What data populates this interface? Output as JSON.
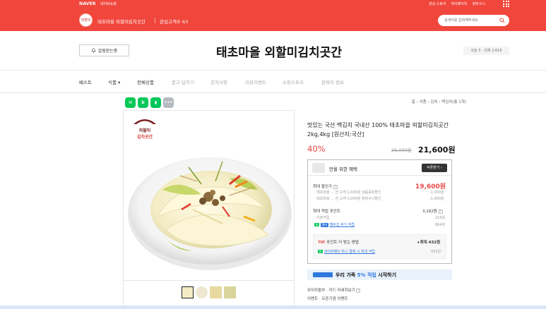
{
  "gnb": {
    "logo": "NAVER",
    "shopping": "네이버쇼핑",
    "links": [
      "관심 스토어",
      "마이페이지",
      "장바구니"
    ]
  },
  "store": {
    "avatar_text": "외할미",
    "name": "태초마을 외할미김치곳간",
    "fav": "관심고객수 63",
    "search_placeholder": "검색어를 입력해주세요"
  },
  "header": {
    "alarm_label": "알림받는중",
    "title": "태초마을 외할미김치곳간",
    "visitors": "오늘 5 · 전체 2,618"
  },
  "categories": [
    "베스트",
    "식품",
    "전체상품",
    "묻고 답하기",
    "공지사항",
    "리뷰이벤트",
    "쇼핑스토리",
    "판매자 정보"
  ],
  "breadcrumb": "홈 › 식품 › 김치 › 백김치(총 1개)",
  "logo_stamp": [
    "외할미",
    "김치곳간"
  ],
  "product": {
    "title": "맛있는 국산 백김치 국내산 100% 태초마을 외할미김치곳간 2kg,4kg [원산지:국산]",
    "discount": "40%",
    "original_price": "36,000원",
    "sale_price": "21,600원"
  },
  "benefit": {
    "title": "만을 위한 혜택",
    "coupon_button": "쿠폰받기 ›",
    "max_discount_label": "최대 할인가",
    "max_discount_value": "19,600원",
    "disc1_label": "· 태초마을 ... 전 고객 1,000원 상품중복할인",
    "disc1_value": "-1,000원",
    "disc2_label": "· 태초마을 ... 전 고객 1,000원 장바구니할인",
    "disc2_value": "-1,000원",
    "points_label": "최대 적립 포인트",
    "points_value": "3,162원",
    "basic_label": "· 기본적립",
    "basic_value": "216원",
    "review_label": "멤버십 후기 적립",
    "review_value": "864원",
    "tip_title": "포인트 더 받는 방법",
    "tip_value": "+최대 432원",
    "tip_item": "네이버페이 머니 결제 시 최대 적립",
    "tip_item_value": "432원"
  },
  "family": {
    "text_before": "우리 가족 ",
    "highlight": "5% 적립",
    "text_after": " 시작하기"
  },
  "extra": {
    "installment": "무이자할부 · 카드 자세히보기",
    "event": "이벤트 · 오픈기념 이벤트"
  },
  "colors": {
    "brand": "#f0463c",
    "discount": "#e84848",
    "npay": "#03c75a",
    "family_blue": "#2f78dd"
  }
}
